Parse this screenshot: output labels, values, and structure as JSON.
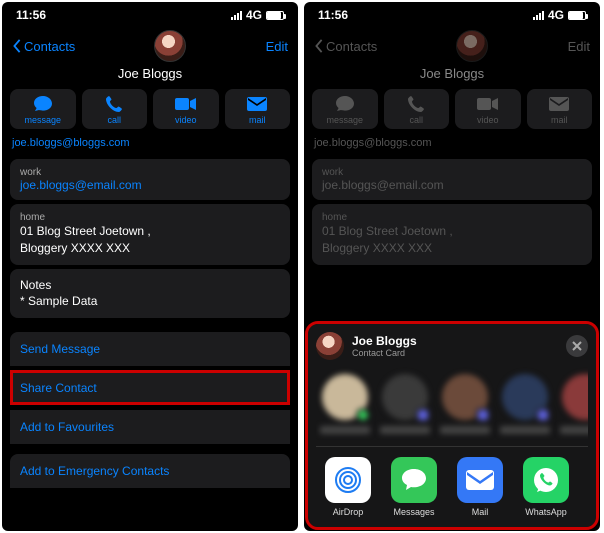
{
  "status": {
    "time": "11:56",
    "network": "4G"
  },
  "nav": {
    "back": "Contacts",
    "edit": "Edit"
  },
  "contact": {
    "name": "Joe Bloggs"
  },
  "actions": {
    "message": "message",
    "call": "call",
    "video": "video",
    "mail": "mail"
  },
  "email_truncated": "joe.bloggs@bloggs.com",
  "work": {
    "label": "work",
    "value": "joe.bloggs@email.com"
  },
  "address": {
    "label": "home",
    "line1": "01 Blog Street Joetown ,",
    "line2": "Bloggery XXXX XXX"
  },
  "notes": {
    "label": "Notes",
    "value": "* Sample Data"
  },
  "rows": {
    "send_message": "Send Message",
    "share_contact": "Share Contact",
    "add_fav": "Add to Favourites",
    "add_emergency": "Add to Emergency Contacts"
  },
  "share_sheet": {
    "title": "Joe Bloggs",
    "subtitle": "Contact Card",
    "apps": {
      "airdrop": "AirDrop",
      "messages": "Messages",
      "mail": "Mail",
      "whatsapp": "WhatsApp"
    }
  },
  "colors": {
    "accent": "#0a84ff",
    "messages_green": "#34c759",
    "mail_blue": "#3478f6",
    "whatsapp": "#25d366",
    "highlight": "#c00"
  }
}
